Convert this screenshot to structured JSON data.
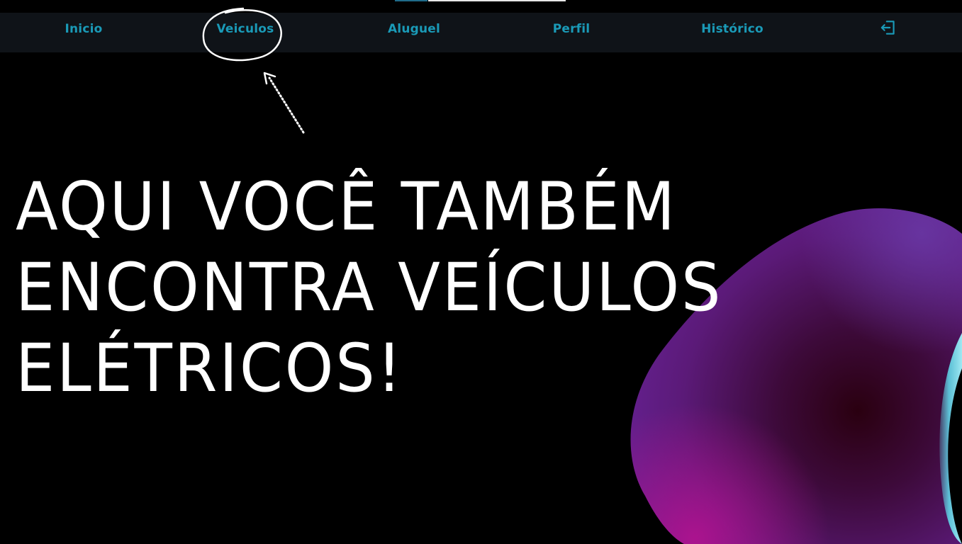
{
  "nav": {
    "items": [
      {
        "label": "Inicio"
      },
      {
        "label": "Veiculos"
      },
      {
        "label": "Aluguel"
      },
      {
        "label": "Perfil"
      },
      {
        "label": "Histórico"
      }
    ],
    "logout_icon": "logout-icon",
    "accent_color": "#1a9ab7"
  },
  "hero": {
    "lines": [
      "AQUI VOCÊ TAMBÉM",
      "ENCONTRA VEÍCULOS",
      "ELÉTRICOS!"
    ]
  },
  "colors": {
    "background": "#000000",
    "navbar": "#0f1318",
    "blob_purple": "#5a1d8a",
    "blob_magenta": "#a0148a",
    "blob_cyan": "#5fd4e6"
  }
}
